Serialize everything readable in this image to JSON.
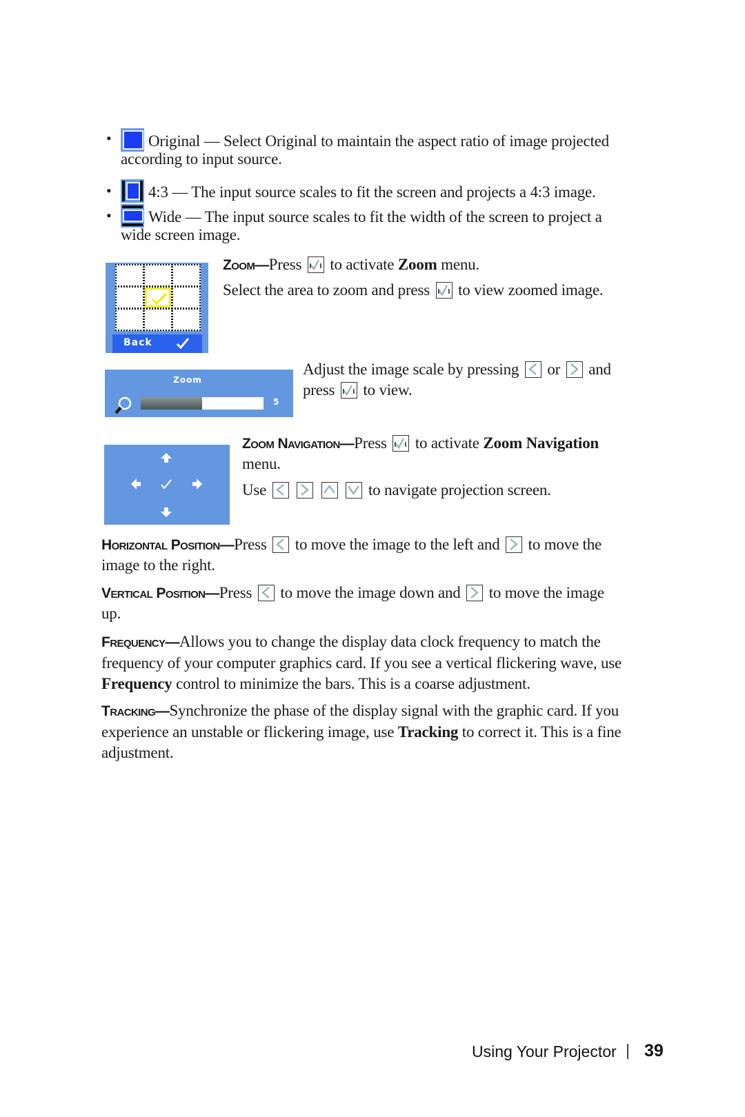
{
  "aspect_options": [
    {
      "icon": "aspect-original-icon",
      "name": "Original",
      "text": "Original — Select Original to maintain the aspect ratio of image projected",
      "cont": "according to input source."
    },
    {
      "icon": "aspect-4-3-icon",
      "name": "4:3",
      "text": "4:3 — The input source scales to fit the screen and projects a 4:3 image."
    },
    {
      "icon": "aspect-wide-icon",
      "name": "Wide",
      "text": "Wide — The input source scales to fit the width of the screen to project a",
      "cont": "wide screen image."
    }
  ],
  "zoom": {
    "heading": "Zoom—",
    "line1_a": "Press",
    "line1_b": "to activate",
    "line1_bold": "Zoom",
    "line1_c": "menu.",
    "line2_a": "Select the area to zoom and press",
    "line2_b": "to view zoomed image.",
    "osd_back_label": "Back",
    "osd_selected_cell": "center"
  },
  "zoom_scale": {
    "osd_title": "Zoom",
    "osd_value": "5",
    "osd_fill_fraction": 0.5,
    "line1_a": "Adjust the image scale by pressing",
    "line1_b": "or",
    "line1_c": "and",
    "line2_a": "press",
    "line2_b": "to view."
  },
  "zoom_navigation": {
    "heading": "Zoom Navigation—",
    "line1_a": "Press",
    "line1_b": "to activate",
    "line1_bold": "Zoom Navigation",
    "line1_c": "menu.",
    "line2_a": "Use",
    "line2_b": "to navigate projection screen."
  },
  "horizontal_position": {
    "heading": "Horizontal Position—",
    "a": "Press",
    "b": "to move the image to the left and",
    "c": "to move the",
    "d": "image to the right."
  },
  "vertical_position": {
    "heading": "Vertical Position—",
    "a": "Press",
    "b": "to move the image down and",
    "c": "to move the image",
    "d": "up."
  },
  "frequency": {
    "heading": "Frequency—",
    "l1": "Allows you to change the display data clock frequency to match the",
    "l2": "frequency of your computer graphics card. If you see a vertical flickering wave, use",
    "l3_bold": "Frequency",
    "l3": " control to minimize the bars. This is a coarse adjustment."
  },
  "tracking": {
    "heading": "Tracking—",
    "l1": "Synchronize the phase of the display signal with the graphic card. If you",
    "l2_a": "experience an unstable or flickering image, use ",
    "l2_bold": "Tracking",
    "l2_b": " to correct it. This is a fine",
    "l3": "adjustment."
  },
  "footer": {
    "section": "Using Your Projector",
    "separator": "|",
    "page": "39"
  }
}
